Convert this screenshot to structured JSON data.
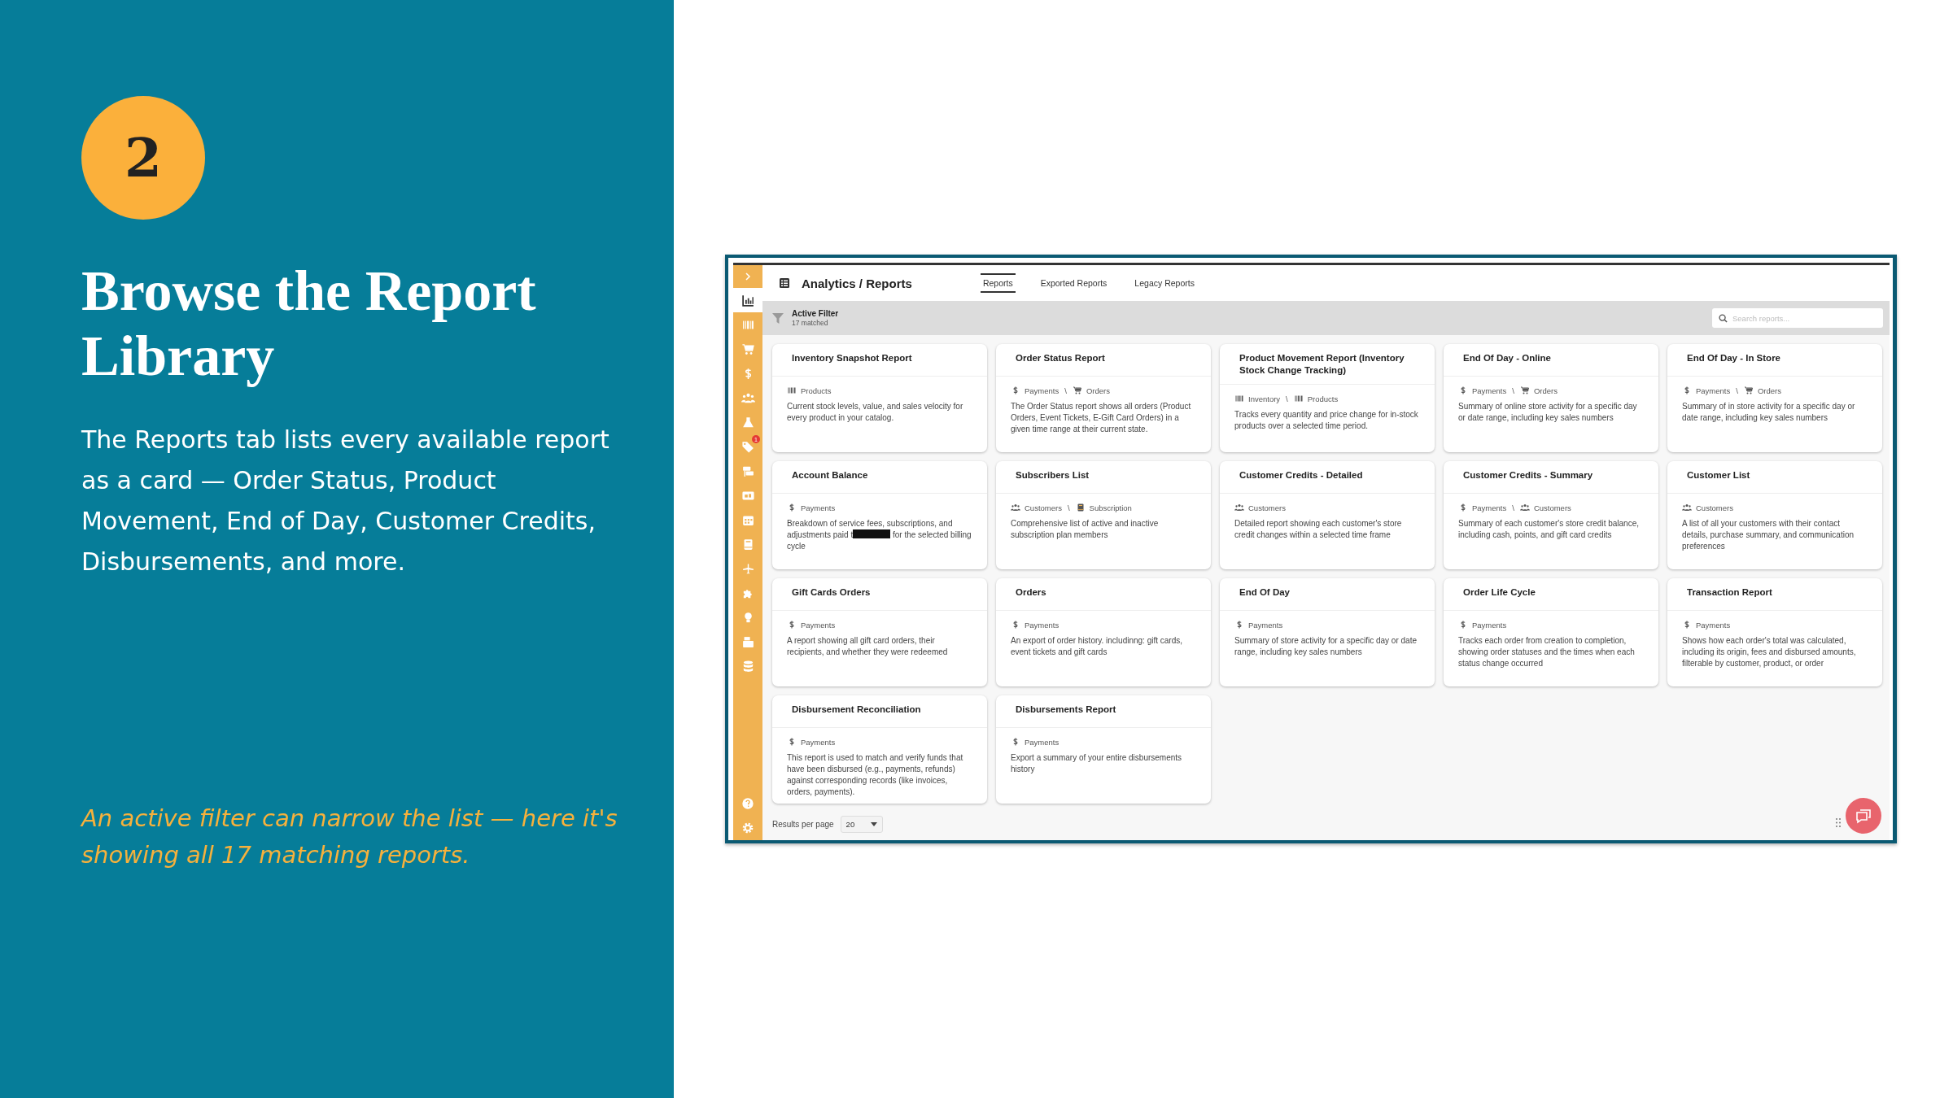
{
  "slide": {
    "step": "2",
    "title": "Browse the Report Library",
    "body": "The Reports tab lists every available report as a card — Order Status, Product Movement, End of Day, Customer Credits, Disbursements, and more.",
    "note": "An active filter can narrow the list — here it's showing all 17 matching reports."
  },
  "app": {
    "title": "Analytics / Reports",
    "tabs": [
      {
        "label": "Reports",
        "selected": true
      },
      {
        "label": "Exported Reports",
        "selected": false
      },
      {
        "label": "Legacy Reports",
        "selected": false
      }
    ],
    "sidebar": {
      "items": [
        {
          "kind": "chart",
          "selected": true
        },
        {
          "kind": "barcode",
          "selected": false
        },
        {
          "kind": "cart",
          "selected": false
        },
        {
          "kind": "dollar",
          "selected": false
        },
        {
          "kind": "people",
          "selected": false
        },
        {
          "kind": "flask",
          "selected": false
        },
        {
          "kind": "tag",
          "selected": false,
          "badge": "1"
        },
        {
          "kind": "signs",
          "selected": false
        },
        {
          "kind": "ad",
          "selected": false
        },
        {
          "kind": "calendar",
          "selected": false
        },
        {
          "kind": "book",
          "selected": false
        },
        {
          "kind": "plane",
          "selected": false
        },
        {
          "kind": "puzzle",
          "selected": false
        },
        {
          "kind": "bulb",
          "selected": false
        },
        {
          "kind": "register",
          "selected": false
        },
        {
          "kind": "database",
          "selected": false
        }
      ],
      "bottom": [
        {
          "kind": "help"
        },
        {
          "kind": "gear"
        }
      ]
    },
    "filter": {
      "title": "Active Filter",
      "count": "17 matched"
    },
    "search": {
      "placeholder": "Search reports..."
    },
    "cards": [
      {
        "title": "Inventory Snapshot Report",
        "tags": [
          {
            "kind": "barcode",
            "label": "Products"
          }
        ],
        "description": "Current stock levels, value, and sales velocity for every product in your catalog."
      },
      {
        "title": "Order Status Report",
        "separator": "\\",
        "tags": [
          {
            "kind": "dollar",
            "label": "Payments"
          },
          {
            "kind": "cart",
            "label": "Orders"
          }
        ],
        "description": "The Order Status report shows all orders (Product Orders, Event Tickets, E-Gift Card Orders) in a given time range at their current state."
      },
      {
        "title": "Product Movement Report (Inventory Stock Change Tracking)",
        "separator": "\\",
        "tags": [
          {
            "kind": "barcode",
            "label": "Inventory"
          },
          {
            "kind": "barcode",
            "label": "Products"
          }
        ],
        "description": "Tracks every quantity and price change for in-stock products over a selected time period."
      },
      {
        "title": "End Of Day - Online",
        "separator": "\\",
        "tags": [
          {
            "kind": "dollar",
            "label": "Payments"
          },
          {
            "kind": "cart",
            "label": "Orders"
          }
        ],
        "description": "Summary of online store activity for a specific day or date range, including key sales numbers"
      },
      {
        "title": "End Of Day - In Store",
        "separator": "\\",
        "tags": [
          {
            "kind": "dollar",
            "label": "Payments"
          },
          {
            "kind": "cart",
            "label": "Orders"
          }
        ],
        "description": "Summary of in store activity for a specific day or date range, including key sales numbers"
      },
      {
        "title": "Account Balance",
        "tags": [
          {
            "kind": "dollar",
            "label": "Payments"
          }
        ],
        "description": "Breakdown of service fees, subscriptions, and adjustments paid t",
        "redacted": true,
        "description_after": "for the selected billing cycle"
      },
      {
        "title": "Subscribers List",
        "separator": "\\",
        "tags": [
          {
            "kind": "people",
            "label": "Customers"
          },
          {
            "kind": "book",
            "label": "Subscription"
          }
        ],
        "description": "Comprehensive list of active and inactive subscription plan members"
      },
      {
        "title": "Customer Credits - Detailed",
        "tags": [
          {
            "kind": "people",
            "label": "Customers"
          }
        ],
        "description": "Detailed report showing each customer's store credit changes within a selected time frame"
      },
      {
        "title": "Customer Credits - Summary",
        "separator": "\\",
        "tags": [
          {
            "kind": "dollar",
            "label": "Payments"
          },
          {
            "kind": "people",
            "label": "Customers"
          }
        ],
        "description": "Summary of each customer's store credit balance, including cash, points, and gift card credits"
      },
      {
        "title": "Customer List",
        "tags": [
          {
            "kind": "people",
            "label": "Customers"
          }
        ],
        "description": "A list of all your customers with their contact details, purchase summary, and communication preferences"
      },
      {
        "title": "Gift Cards Orders",
        "tags": [
          {
            "kind": "dollar",
            "label": "Payments"
          }
        ],
        "description": "A report showing all gift card orders, their recipients, and whether they were redeemed"
      },
      {
        "title": "Orders",
        "tags": [
          {
            "kind": "dollar",
            "label": "Payments"
          }
        ],
        "description": "An export of order history. includinng: gift cards, event tickets and gift cards"
      },
      {
        "title": "End Of Day",
        "tags": [
          {
            "kind": "dollar",
            "label": "Payments"
          }
        ],
        "description": "Summary of store activity for a specific day or date range, including key sales numbers"
      },
      {
        "title": "Order Life Cycle",
        "tags": [
          {
            "kind": "dollar",
            "label": "Payments"
          }
        ],
        "description": "Tracks each order from creation to completion, showing order statuses and the times when each status change occurred"
      },
      {
        "title": "Transaction Report",
        "tags": [
          {
            "kind": "dollar",
            "label": "Payments"
          }
        ],
        "description": "Shows how each order's total was calculated, including its origin, fees and disbursed amounts, filterable by customer, product, or order"
      },
      {
        "title": "Disbursement Reconciliation",
        "tags": [
          {
            "kind": "dollar",
            "label": "Payments"
          }
        ],
        "description": "This report is used to match and verify funds that have been disbursed (e.g., payments, refunds) against corresponding records (like invoices, orders, payments)."
      },
      {
        "title": "Disbursements Report",
        "tags": [
          {
            "kind": "dollar",
            "label": "Payments"
          }
        ],
        "description": "Export a summary of your entire disbursements history"
      }
    ],
    "pagination": {
      "label": "Results per page",
      "value": "20"
    }
  }
}
